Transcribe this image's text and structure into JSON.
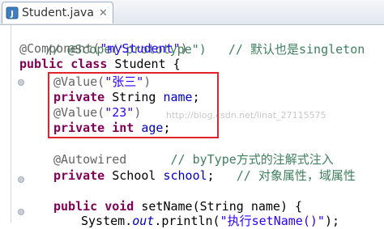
{
  "tab": {
    "icon": "java-class-file-icon",
    "label": "Student.java",
    "close": "✕"
  },
  "watermark": "http://blog.csdn.net/linat_27115575",
  "lines": {
    "l1": {
      "indent": "  ",
      "comment": "// @Scope(\"prototype\")   // 默认也是singleton"
    },
    "l2": {
      "ann": "@Component(",
      "str": "\"myStudent\"",
      "close": ")"
    },
    "l3": {
      "kw1": "public",
      "kw2": "class",
      "name": " Student {"
    },
    "l4": {
      "ann": "@Value(",
      "str": "\"张三\"",
      "close": ")"
    },
    "l5": {
      "kw": "private",
      "type": " String ",
      "fld": "name",
      "end": ";"
    },
    "l6": {
      "ann": "@Value(",
      "str": "\"23\"",
      "close": ")"
    },
    "l7": {
      "kw1": "private",
      "kw2": "int",
      "fld": "age",
      "end": ";"
    },
    "l8": {
      "ann": "@Autowired",
      "comment": "// byType方式的注解式注入"
    },
    "l9": {
      "kw": "private",
      "type": " School ",
      "fld": "school",
      "end": ";",
      "comment": "// 对象属性，域属性"
    },
    "l10": {
      "kw1": "public",
      "kw2": "void",
      "rest": " setName(String name) {"
    },
    "l11": {
      "pre": "System.",
      "ital": "out",
      "mid": ".println(",
      "str": "\"执行setName()\"",
      "end": ");"
    }
  }
}
